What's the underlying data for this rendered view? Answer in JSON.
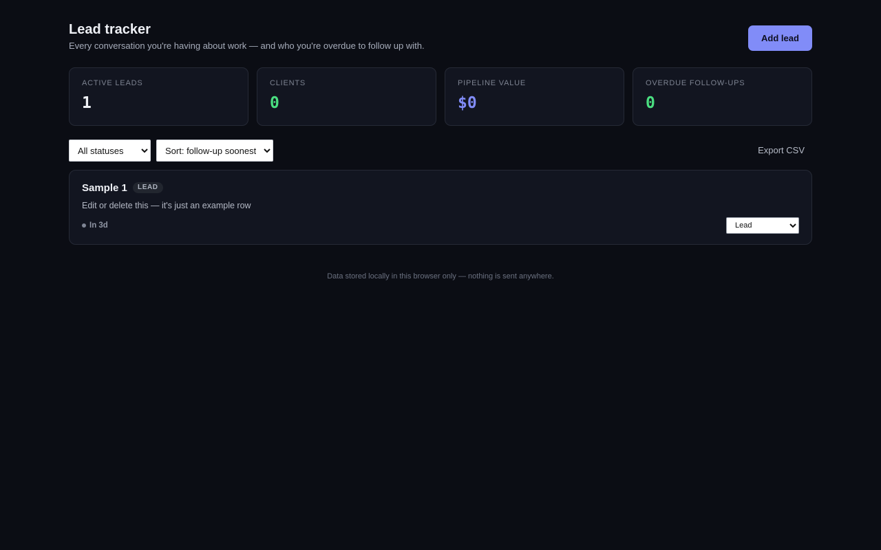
{
  "header": {
    "title": "Lead tracker",
    "subtitle": "Every conversation you're having about work — and who you're overdue to follow up with.",
    "add_button": "Add lead"
  },
  "stats": [
    {
      "label": "ACTIVE LEADS",
      "value": "1",
      "color": "#eef0f5"
    },
    {
      "label": "CLIENTS",
      "value": "0",
      "color": "#4ade80"
    },
    {
      "label": "PIPELINE VALUE",
      "value": "$0",
      "color": "#818cf8"
    },
    {
      "label": "OVERDUE FOLLOW-UPS",
      "value": "0",
      "color": "#4ade80"
    }
  ],
  "controls": {
    "status_filter": "All statuses",
    "sort": "Sort: follow-up soonest",
    "export": "Export CSV"
  },
  "leads": [
    {
      "name": "Sample 1",
      "badge": "LEAD",
      "note": "Edit or delete this — it's just an example row",
      "followup": "In 3d",
      "status": "Lead"
    }
  ],
  "footer": "Data stored locally in this browser only — nothing is sent anywhere.",
  "colors": {
    "background": "#0b0d14",
    "card": "#121520",
    "accent": "#818cf8",
    "positive": "#4ade80"
  }
}
